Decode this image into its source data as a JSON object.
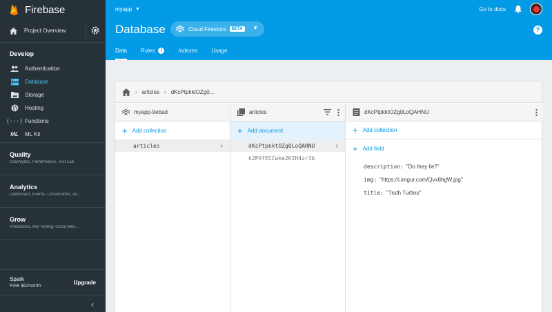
{
  "app": {
    "name": "Firebase"
  },
  "sidebar": {
    "project_overview": "Project Overview",
    "develop": {
      "title": "Develop",
      "items": [
        {
          "label": "Authentication",
          "icon": "people-icon"
        },
        {
          "label": "Database",
          "icon": "database-icon",
          "active": true
        },
        {
          "label": "Storage",
          "icon": "storage-icon"
        },
        {
          "label": "Hosting",
          "icon": "globe-icon"
        },
        {
          "label": "Functions",
          "icon": "functions-icon"
        },
        {
          "label": "ML Kit",
          "icon": "ml-kit-icon"
        }
      ]
    },
    "quality": {
      "title": "Quality",
      "subtitle": "Crashlytics, Performance, Test Lab"
    },
    "analytics": {
      "title": "Analytics",
      "subtitle": "Dashboard, Events, Conversions, Au..."
    },
    "grow": {
      "title": "Grow",
      "subtitle": "Predictions, A/B Testing, Cloud Mes..."
    },
    "plan": {
      "name": "Spark",
      "price": "Free $0/month",
      "upgrade": "Upgrade"
    }
  },
  "header": {
    "project": "myapp",
    "go_to_docs": "Go to docs",
    "title": "Database",
    "db_selector": {
      "label": "Cloud Firestore",
      "badge": "BETA"
    },
    "help": "?",
    "tabs": [
      {
        "label": "Data",
        "active": true
      },
      {
        "label": "Rules",
        "info": "!"
      },
      {
        "label": "Indexes"
      },
      {
        "label": "Usage"
      }
    ]
  },
  "viewer": {
    "breadcrumb": [
      "articles",
      "dKcPtpkktOZg0..."
    ],
    "root": {
      "name": "myapp-9ebad",
      "add_label": "Add collection",
      "collections": [
        "articles"
      ]
    },
    "collection": {
      "name": "articles",
      "add_label": "Add document",
      "documents": [
        "dKcPtpkktOZg0LoQAHNU",
        "k2PXfECCwke2KIH4zr3b"
      ]
    },
    "document": {
      "name": "dKcPtpkktOZg0LoQAHNU",
      "add_collection_label": "Add collection",
      "add_field_label": "Add field",
      "fields": [
        {
          "key": "description:",
          "value": "\"Do they lie?\""
        },
        {
          "key": "img:",
          "value": "\"https://i.imgur.com/Qvx8hgW.jpg\""
        },
        {
          "key": "title:",
          "value": "\"Truth Turtles\""
        }
      ]
    }
  },
  "colors": {
    "sidebar": "#263238",
    "header": "#039be5",
    "accent": "#039be5",
    "active_nav": "#4fc3f7"
  }
}
